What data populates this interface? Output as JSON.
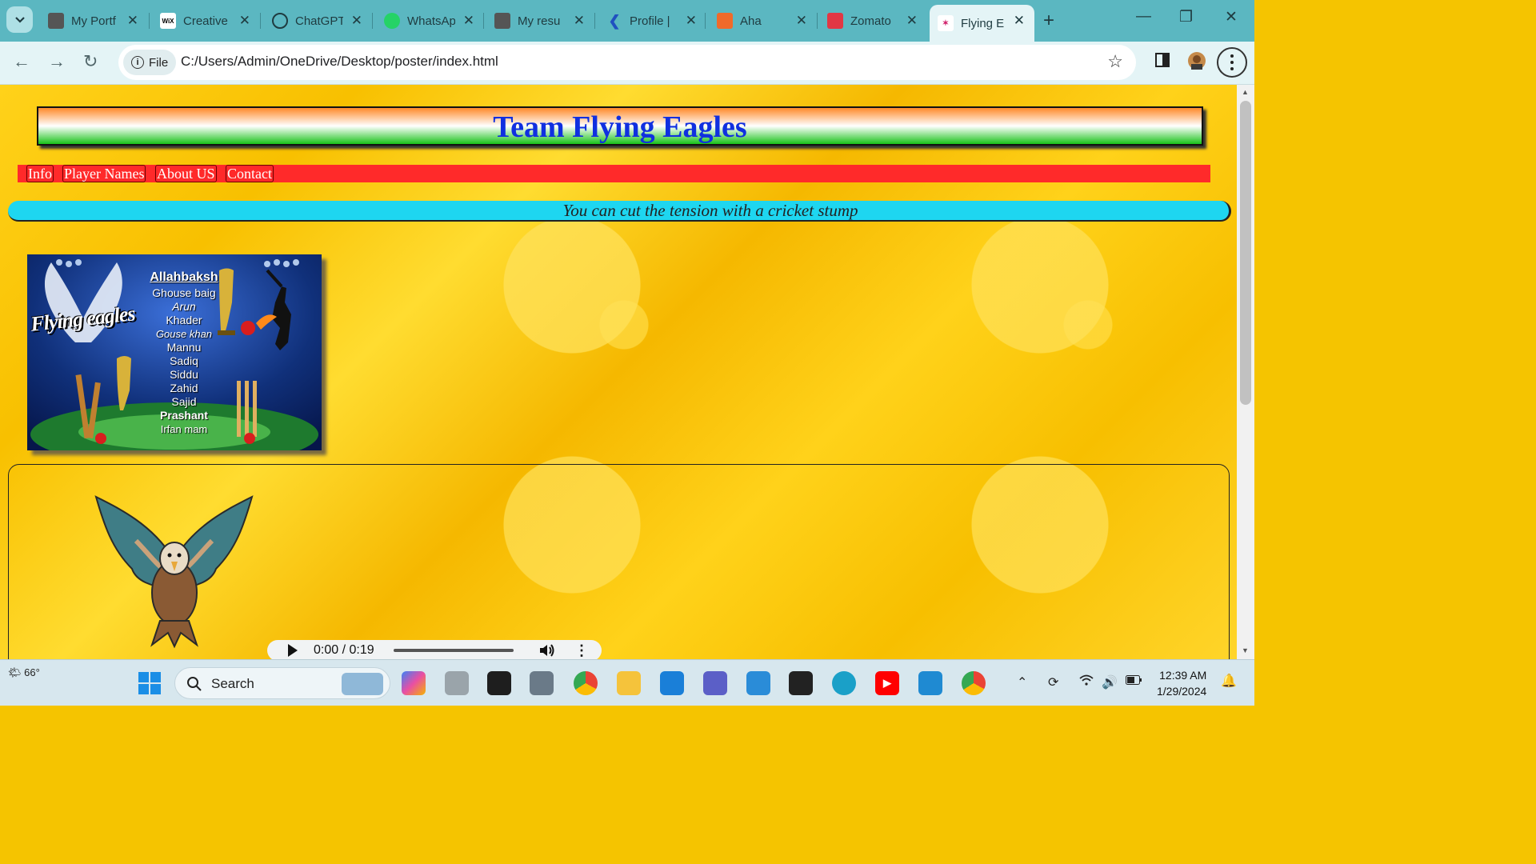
{
  "browser": {
    "tabs": [
      {
        "title": "My Portf",
        "favicon": "portfolio-icon"
      },
      {
        "title": "Creative",
        "favicon": "wix-icon"
      },
      {
        "title": "ChatGPT",
        "favicon": "chatgpt-icon"
      },
      {
        "title": "WhatsApp",
        "favicon": "whatsapp-icon"
      },
      {
        "title": "My resu",
        "favicon": "resume-icon"
      },
      {
        "title": "Profile |",
        "favicon": "profile-icon"
      },
      {
        "title": "Aha",
        "favicon": "aha-icon"
      },
      {
        "title": "Zomato",
        "favicon": "zomato-icon"
      },
      {
        "title": "Flying E",
        "favicon": "flying-eagles-icon",
        "active": true
      }
    ],
    "wix_favicon_text": "WiX",
    "address": {
      "scheme_label": "File",
      "url": "C:/Users/Admin/OneDrive/Desktop/poster/index.html"
    }
  },
  "page": {
    "title": "Team Flying Eagles",
    "nav": [
      "Info",
      "Player Names",
      "About US",
      "Contact"
    ],
    "tagline": "You can cut the tension with a cricket stump",
    "poster": {
      "brand": "Flying eagles",
      "players": [
        "Allahbaksh",
        "Ghouse baig",
        "Arun",
        "Khader",
        "Gouse khan",
        "Mannu",
        "Sadiq",
        "Siddu",
        "Zahid",
        "Sajid",
        "Prashant",
        "Irfan mam"
      ]
    },
    "audio": {
      "time": "0:00 / 0:19",
      "progress": 0
    }
  },
  "taskbar": {
    "weather": "66°",
    "search_label": "Search",
    "time": "12:39 AM",
    "date": "1/29/2024"
  },
  "colors": {
    "title_text": "#1030e0",
    "nav_bar": "#ff2a2a",
    "tagline_bar": "#1ed6f0",
    "page_background": "#f5c400"
  }
}
